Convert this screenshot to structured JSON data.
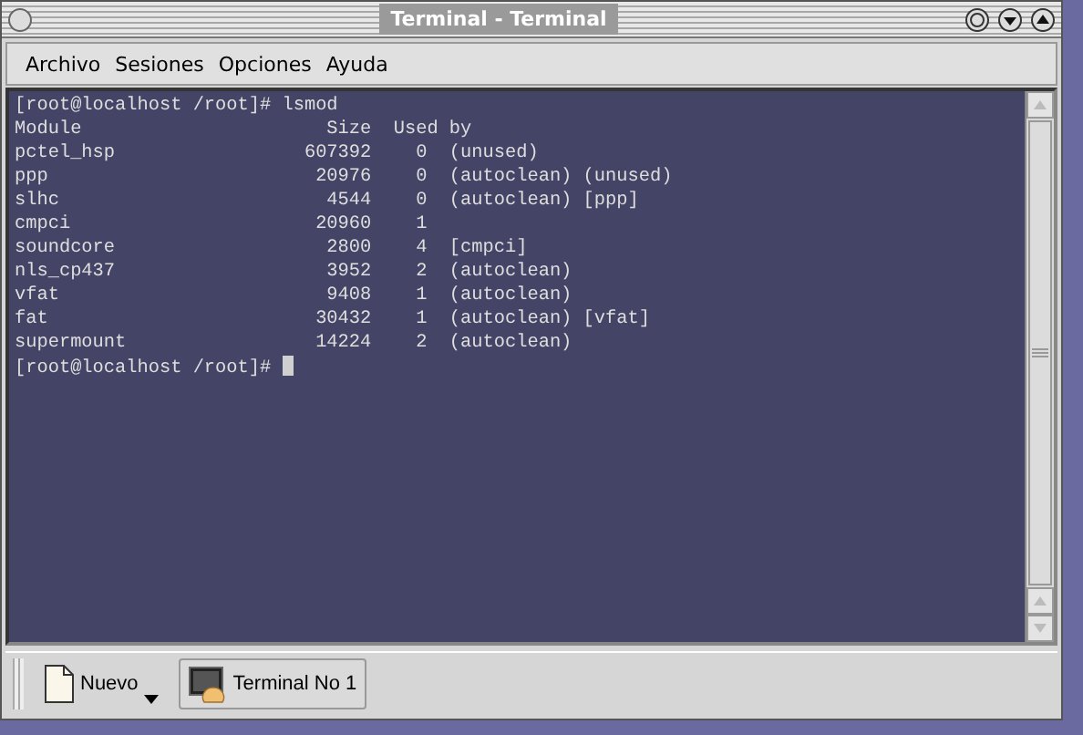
{
  "window": {
    "title": "Terminal - Terminal"
  },
  "menu": [
    "Archivo",
    "Sesiones",
    "Opciones",
    "Ayuda"
  ],
  "terminal": {
    "command_line": "[root@localhost /root]# lsmod",
    "columns": [
      "Module",
      "Size",
      "Used by"
    ],
    "rows": [
      {
        "module": "pctel_hsp",
        "size": "607392",
        "count": "0",
        "used_by": "(unused)"
      },
      {
        "module": "ppp",
        "size": "20976",
        "count": "0",
        "used_by": "(autoclean) (unused)"
      },
      {
        "module": "slhc",
        "size": "4544",
        "count": "0",
        "used_by": "(autoclean) [ppp]"
      },
      {
        "module": "cmpci",
        "size": "20960",
        "count": "1",
        "used_by": ""
      },
      {
        "module": "soundcore",
        "size": "2800",
        "count": "4",
        "used_by": "[cmpci]"
      },
      {
        "module": "nls_cp437",
        "size": "3952",
        "count": "2",
        "used_by": "(autoclean)"
      },
      {
        "module": "vfat",
        "size": "9408",
        "count": "1",
        "used_by": "(autoclean)"
      },
      {
        "module": "fat",
        "size": "30432",
        "count": "1",
        "used_by": "(autoclean) [vfat]"
      },
      {
        "module": "supermount",
        "size": "14224",
        "count": "2",
        "used_by": "(autoclean)"
      }
    ],
    "prompt": "[root@localhost /root]#"
  },
  "taskbar": [
    {
      "kind": "launcher",
      "label": "Nuevo"
    },
    {
      "kind": "task",
      "label": "Terminal No 1"
    }
  ]
}
